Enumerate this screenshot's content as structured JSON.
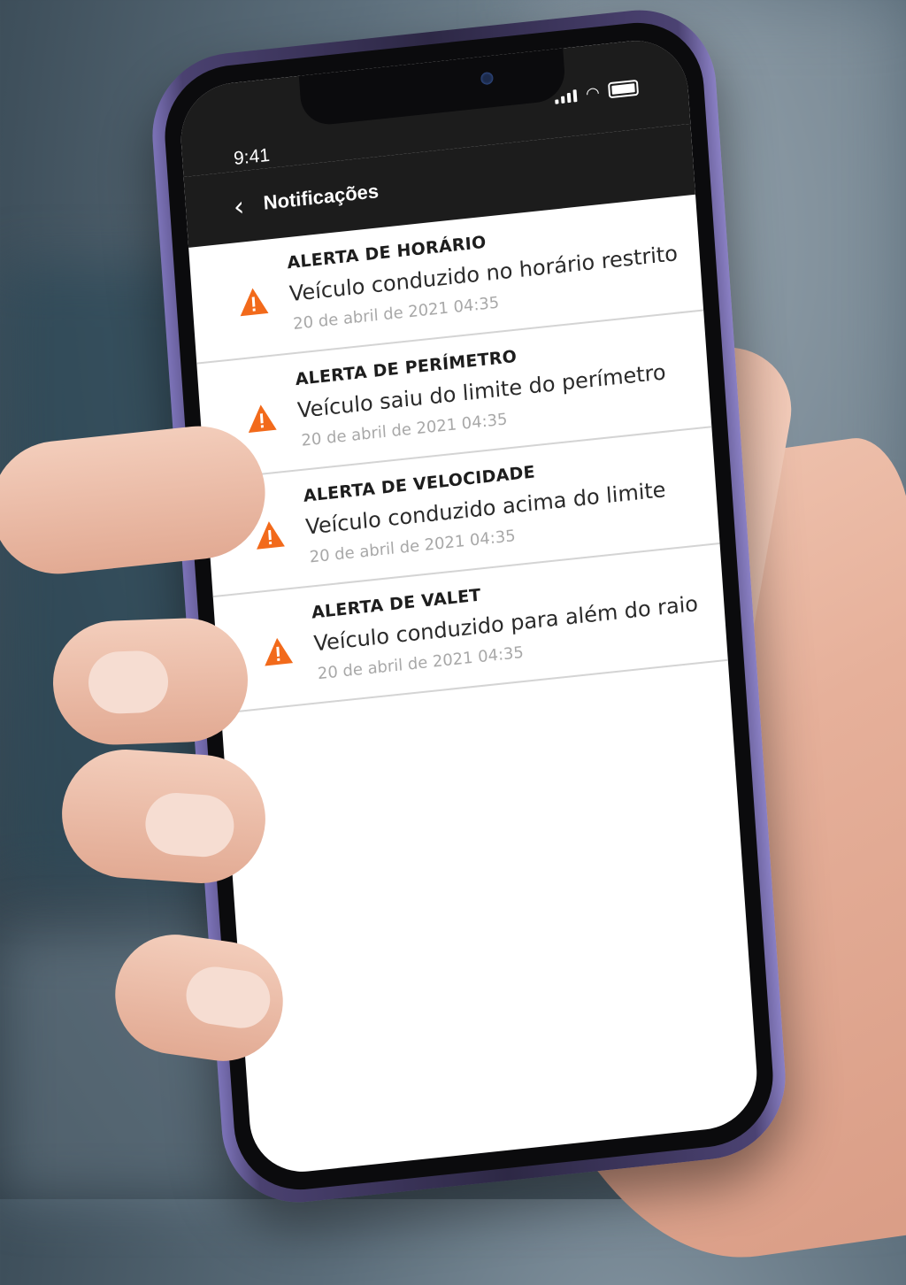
{
  "status_bar": {
    "time": "9:41",
    "icons": [
      "signal-icon",
      "wifi-icon",
      "battery-icon"
    ]
  },
  "header": {
    "back_icon": "chevron-left-icon",
    "title": "Notificações"
  },
  "notifications": [
    {
      "title": "ALERTA DE HORÁRIO",
      "message": "Veículo conduzido no horário restrito",
      "date": "20 de abril de 2021 04:35",
      "icon": "warning-icon"
    },
    {
      "title": "ALERTA DE PERÍMETRO",
      "message": "Veículo saiu do limite do perímetro",
      "date": "20 de abril de 2021 04:35",
      "icon": "warning-icon"
    },
    {
      "title": "ALERTA DE VELOCIDADE",
      "message": "Veículo conduzido acima do limite",
      "date": "20 de abril de 2021 04:35",
      "icon": "warning-icon"
    },
    {
      "title": "ALERTA DE VALET",
      "message": "Veículo conduzido para além do raio",
      "date": "20 de abril de 2021 04:35",
      "icon": "warning-icon"
    }
  ],
  "colors": {
    "header_bg": "#1c1c1c",
    "warning": "#f26a1b",
    "title_text": "#1d1d1d",
    "date_text": "#a8a8a8"
  }
}
